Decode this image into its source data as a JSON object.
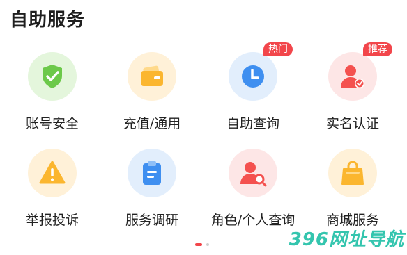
{
  "section": {
    "title": "自助服务"
  },
  "items": [
    {
      "label": "账号安全",
      "icon": "shield-check-icon",
      "halo": "#e4f6dc",
      "color": "#6cc94a"
    },
    {
      "label": "充值/通用",
      "icon": "wallet-icon",
      "halo": "#fff1d8",
      "color": "#fbb62f"
    },
    {
      "label": "自助查询",
      "icon": "clock-icon",
      "halo": "#e2eefc",
      "color": "#3f8ff0",
      "badge": "热门"
    },
    {
      "label": "实名认证",
      "icon": "user-verified-icon",
      "halo": "#fde6e6",
      "color": "#f4514f",
      "badge": "推荐"
    },
    {
      "label": "举报投诉",
      "icon": "warning-icon",
      "halo": "#fff1d8",
      "color": "#fbb62f"
    },
    {
      "label": "服务调研",
      "icon": "clipboard-icon",
      "halo": "#e2eefc",
      "color": "#3f8ff0"
    },
    {
      "label": "角色/个人查询",
      "icon": "user-search-icon",
      "halo": "#fde6e6",
      "color": "#f4514f"
    },
    {
      "label": "商城服务",
      "icon": "shopping-bag-icon",
      "halo": "#fff1d8",
      "color": "#fbb62f"
    }
  ],
  "pager": {
    "active_page": 1,
    "total_pages": 2
  },
  "watermark": "396网址导航"
}
